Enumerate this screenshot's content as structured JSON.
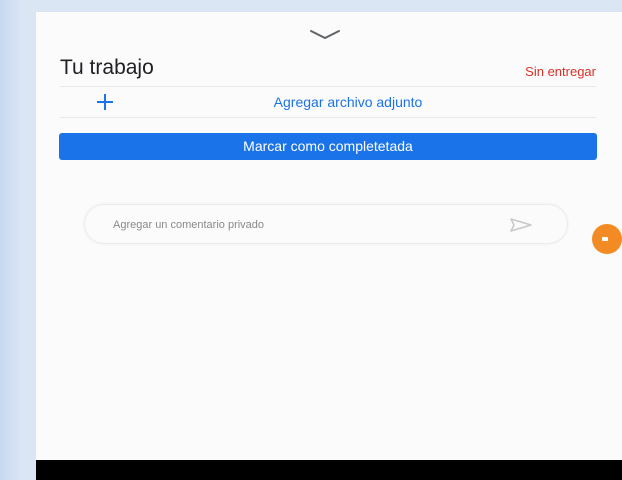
{
  "work_section": {
    "title": "Tu trabajo",
    "status": "Sin entregar",
    "attach_label": "Agregar archivo adjunto",
    "attach_icon": "plus-icon",
    "complete_label": "Marcar como completetada"
  },
  "comment": {
    "placeholder": "Agregar un comentario privado",
    "send_icon": "send-icon"
  },
  "colors": {
    "accent": "#1a73e8",
    "status": "#d93025",
    "fab": "#f28b24"
  },
  "icons": {
    "handle": "chevron-down-icon",
    "fab": "floating-action-icon"
  }
}
